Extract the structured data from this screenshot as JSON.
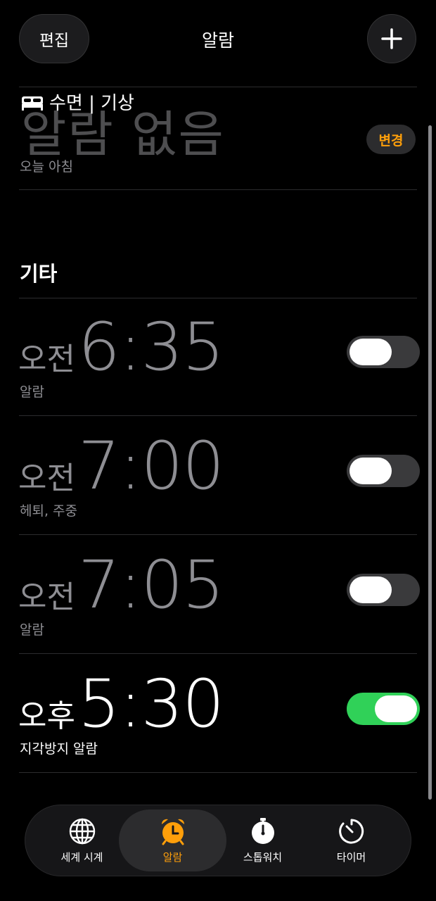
{
  "header": {
    "edit_label": "편집",
    "title": "알람"
  },
  "sleep": {
    "heading": "수면 | 기상",
    "no_alarm": "알람 없음",
    "subtitle": "오늘 아침",
    "change_label": "변경"
  },
  "other": {
    "heading": "기타"
  },
  "alarms": [
    {
      "ampm": "오전",
      "time": "6:35",
      "label": "알람",
      "enabled": false
    },
    {
      "ampm": "오전",
      "time": "7:00",
      "label": "헤퇴, 주중",
      "enabled": false
    },
    {
      "ampm": "오전",
      "time": "7:05",
      "label": "알람",
      "enabled": false
    },
    {
      "ampm": "오후",
      "time": "5:30",
      "label": "지각방지 알람",
      "enabled": true
    }
  ],
  "tabs": [
    {
      "label": "세계 시계",
      "icon": "globe-icon"
    },
    {
      "label": "알람",
      "icon": "alarm-clock-icon",
      "active": true
    },
    {
      "label": "스톱워치",
      "icon": "stopwatch-icon"
    },
    {
      "label": "타이머",
      "icon": "timer-icon"
    }
  ],
  "colors": {
    "accent": "#ff9f0a",
    "toggle_on": "#30d158",
    "toggle_off": "#3a3a3c",
    "muted_text": "#8e8e93"
  }
}
